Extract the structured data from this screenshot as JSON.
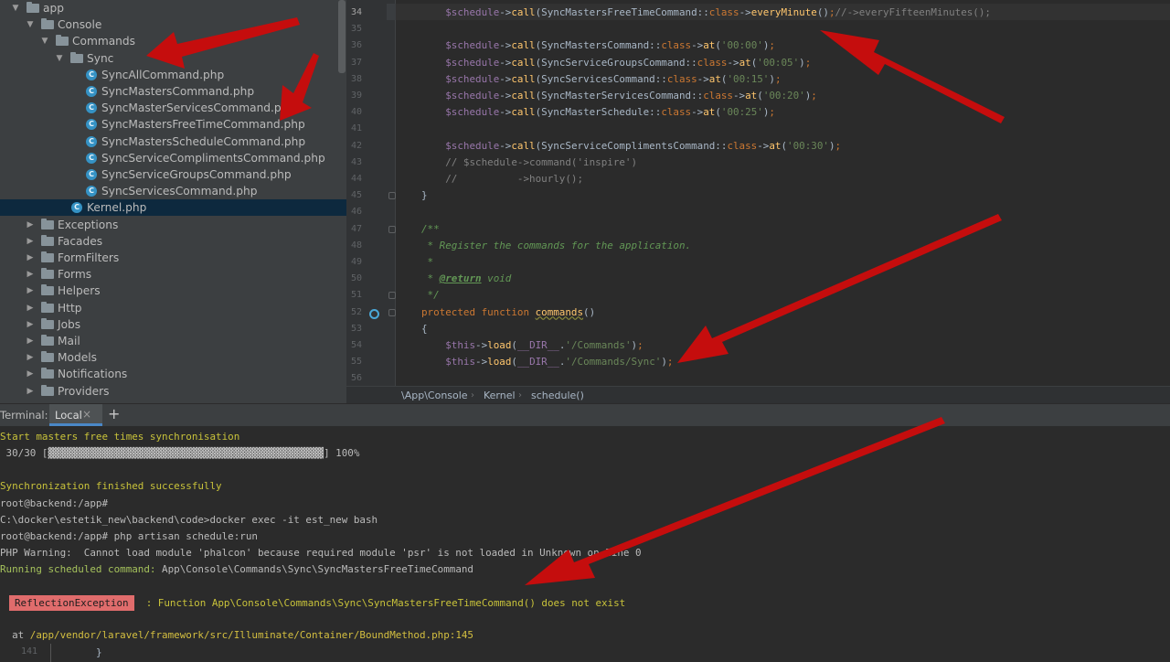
{
  "tree": {
    "items": [
      {
        "label": "app",
        "kind": "folder",
        "open": true,
        "depth": 0
      },
      {
        "label": "Console",
        "kind": "folder",
        "open": true,
        "depth": 1
      },
      {
        "label": "Commands",
        "kind": "folder",
        "open": true,
        "depth": 2
      },
      {
        "label": "Sync",
        "kind": "folder",
        "open": true,
        "depth": 3
      },
      {
        "label": "SyncAllCommand.php",
        "kind": "php",
        "depth": 4
      },
      {
        "label": "SyncMastersCommand.php",
        "kind": "php",
        "depth": 4
      },
      {
        "label": "SyncMasterServicesCommand.php",
        "kind": "php",
        "depth": 4
      },
      {
        "label": "SyncMastersFreeTimeCommand.php",
        "kind": "php",
        "depth": 4
      },
      {
        "label": "SyncMastersScheduleCommand.php",
        "kind": "php",
        "depth": 4
      },
      {
        "label": "SyncServiceComplimentsCommand.php",
        "kind": "php",
        "depth": 4
      },
      {
        "label": "SyncServiceGroupsCommand.php",
        "kind": "php",
        "depth": 4
      },
      {
        "label": "SyncServicesCommand.php",
        "kind": "php",
        "depth": 4
      },
      {
        "label": "Kernel.php",
        "kind": "php",
        "depth": 3,
        "selected": true
      },
      {
        "label": "Exceptions",
        "kind": "folder",
        "open": false,
        "depth": 1
      },
      {
        "label": "Facades",
        "kind": "folder",
        "open": false,
        "depth": 1
      },
      {
        "label": "FormFilters",
        "kind": "folder",
        "open": false,
        "depth": 1
      },
      {
        "label": "Forms",
        "kind": "folder",
        "open": false,
        "depth": 1
      },
      {
        "label": "Helpers",
        "kind": "folder",
        "open": false,
        "depth": 1
      },
      {
        "label": "Http",
        "kind": "folder",
        "open": false,
        "depth": 1
      },
      {
        "label": "Jobs",
        "kind": "folder",
        "open": false,
        "depth": 1
      },
      {
        "label": "Mail",
        "kind": "folder",
        "open": false,
        "depth": 1
      },
      {
        "label": "Models",
        "kind": "folder",
        "open": false,
        "depth": 1
      },
      {
        "label": "Notifications",
        "kind": "folder",
        "open": false,
        "depth": 1
      },
      {
        "label": "Providers",
        "kind": "folder",
        "open": false,
        "depth": 1
      }
    ]
  },
  "editor": {
    "current_line": "34",
    "lines": [
      {
        "n": "34",
        "parts": [
          [
            "v",
            "$schedule"
          ],
          [
            "",
            "->"
          ],
          [
            "m",
            "call"
          ],
          [
            "",
            "(SyncMastersFreeTimeCommand::"
          ],
          [
            "k",
            "class"
          ],
          [
            "",
            "->"
          ],
          [
            "m",
            "everyMinute"
          ],
          [
            "",
            "()"
          ],
          [
            "k",
            ";"
          ],
          [
            "cm",
            "//->everyFifteenMinutes();"
          ]
        ],
        "indent": "    "
      },
      {
        "n": "35",
        "parts": [],
        "indent": ""
      },
      {
        "n": "36",
        "parts": [
          [
            "v",
            "$schedule"
          ],
          [
            "",
            "->"
          ],
          [
            "m",
            "call"
          ],
          [
            "",
            "(SyncMastersCommand::"
          ],
          [
            "k",
            "class"
          ],
          [
            "",
            "->"
          ],
          [
            "m",
            "at"
          ],
          [
            "",
            "("
          ],
          [
            "s",
            "'00:00'"
          ],
          [
            "",
            ")"
          ],
          [
            "k",
            ";"
          ]
        ],
        "indent": "    "
      },
      {
        "n": "37",
        "parts": [
          [
            "v",
            "$schedule"
          ],
          [
            "",
            "->"
          ],
          [
            "m",
            "call"
          ],
          [
            "",
            "(SyncServiceGroupsCommand::"
          ],
          [
            "k",
            "class"
          ],
          [
            "",
            "->"
          ],
          [
            "m",
            "at"
          ],
          [
            "",
            "("
          ],
          [
            "s",
            "'00:05'"
          ],
          [
            "",
            ")"
          ],
          [
            "k",
            ";"
          ]
        ],
        "indent": "    "
      },
      {
        "n": "38",
        "parts": [
          [
            "v",
            "$schedule"
          ],
          [
            "",
            "->"
          ],
          [
            "m",
            "call"
          ],
          [
            "",
            "(SyncServicesCommand::"
          ],
          [
            "k",
            "class"
          ],
          [
            "",
            "->"
          ],
          [
            "m",
            "at"
          ],
          [
            "",
            "("
          ],
          [
            "s",
            "'00:15'"
          ],
          [
            "",
            ")"
          ],
          [
            "k",
            ";"
          ]
        ],
        "indent": "    "
      },
      {
        "n": "39",
        "parts": [
          [
            "v",
            "$schedule"
          ],
          [
            "",
            "->"
          ],
          [
            "m",
            "call"
          ],
          [
            "",
            "(SyncMasterServicesCommand::"
          ],
          [
            "k",
            "class"
          ],
          [
            "",
            "->"
          ],
          [
            "m",
            "at"
          ],
          [
            "",
            "("
          ],
          [
            "s",
            "'00:20'"
          ],
          [
            "",
            ")"
          ],
          [
            "k",
            ";"
          ]
        ],
        "indent": "    "
      },
      {
        "n": "40",
        "parts": [
          [
            "v",
            "$schedule"
          ],
          [
            "",
            "->"
          ],
          [
            "m",
            "call"
          ],
          [
            "",
            "(SyncMasterSchedule::"
          ],
          [
            "k",
            "class"
          ],
          [
            "",
            "->"
          ],
          [
            "m",
            "at"
          ],
          [
            "",
            "("
          ],
          [
            "s",
            "'00:25'"
          ],
          [
            "",
            ")"
          ],
          [
            "k",
            ";"
          ]
        ],
        "indent": "    "
      },
      {
        "n": "41",
        "parts": [],
        "indent": ""
      },
      {
        "n": "42",
        "parts": [
          [
            "v",
            "$schedule"
          ],
          [
            "",
            "->"
          ],
          [
            "m",
            "call"
          ],
          [
            "",
            "(SyncServiceComplimentsCommand::"
          ],
          [
            "k",
            "class"
          ],
          [
            "",
            "->"
          ],
          [
            "m",
            "at"
          ],
          [
            "",
            "("
          ],
          [
            "s",
            "'00:30'"
          ],
          [
            "",
            ")"
          ],
          [
            "k",
            ";"
          ]
        ],
        "indent": "    "
      },
      {
        "n": "43",
        "parts": [
          [
            "cm",
            "// $schedule->command('inspire')"
          ]
        ],
        "indent": "    "
      },
      {
        "n": "44",
        "parts": [
          [
            "cm",
            "//          ->hourly();"
          ]
        ],
        "indent": "    "
      },
      {
        "n": "45",
        "parts": [
          [
            "",
            "}"
          ]
        ],
        "indent": ""
      },
      {
        "n": "46",
        "parts": [],
        "indent": ""
      },
      {
        "n": "47",
        "parts": [
          [
            "dc",
            "/**"
          ]
        ],
        "indent": ""
      },
      {
        "n": "48",
        "parts": [
          [
            "dc",
            " * Register the commands for the application."
          ]
        ],
        "indent": ""
      },
      {
        "n": "49",
        "parts": [
          [
            "dc",
            " *"
          ]
        ],
        "indent": ""
      },
      {
        "n": "50",
        "parts": [
          [
            "dc",
            " * "
          ],
          [
            "dt",
            "@return"
          ],
          [
            "dc",
            " void"
          ]
        ],
        "indent": ""
      },
      {
        "n": "51",
        "parts": [
          [
            "dc",
            " */"
          ]
        ],
        "indent": ""
      },
      {
        "n": "52",
        "parts": [
          [
            "k",
            "protected function "
          ],
          [
            "mw",
            "commands"
          ],
          [
            "",
            "()"
          ]
        ],
        "indent": ""
      },
      {
        "n": "53",
        "parts": [
          [
            "",
            "{"
          ]
        ],
        "indent": ""
      },
      {
        "n": "54",
        "parts": [
          [
            "v",
            "$this"
          ],
          [
            "",
            "->"
          ],
          [
            "m",
            "load"
          ],
          [
            "",
            "("
          ],
          [
            "v",
            "__DIR__"
          ],
          [
            "",
            "."
          ],
          [
            "s",
            "'/Commands'"
          ],
          [
            "",
            ")"
          ],
          [
            "k",
            ";"
          ]
        ],
        "indent": "    "
      },
      {
        "n": "55",
        "parts": [
          [
            "v",
            "$this"
          ],
          [
            "",
            "->"
          ],
          [
            "m",
            "load"
          ],
          [
            "",
            "("
          ],
          [
            "v",
            "__DIR__"
          ],
          [
            "",
            "."
          ],
          [
            "s",
            "'/Commands/Sync'"
          ],
          [
            "",
            ")"
          ],
          [
            "k",
            ";"
          ]
        ],
        "indent": "    "
      },
      {
        "n": "56",
        "parts": [],
        "indent": ""
      }
    ]
  },
  "breadcrumb": {
    "items": [
      "\\App\\Console",
      "Kernel",
      "schedule()"
    ]
  },
  "terminal": {
    "label": "Terminal:",
    "tab_label": "Local",
    "tab_close": "×",
    "add_tab": "+",
    "lines": {
      "start": "Start masters free times synchronisation",
      "progress": " 30/30 [▓▓▓▓▓▓▓▓▓▓▓▓▓▓▓▓▓▓▓▓▓▓▓▓▓▓▓▓▓▓▓▓▓▓▓▓▓▓▓▓▓▓▓▓▓▓] 100%",
      "finished": "Synchronization finished successfully",
      "prompt1": "root@backend:/app#",
      "docker_cmd": "C:\\docker\\estetik_new\\backend\\code>docker exec -it est_new bash",
      "prompt2": "root@backend:/app# php artisan schedule:run",
      "warning": "PHP Warning:  Cannot load module 'phalcon' because required module 'psr' is not loaded in Unknown on line 0",
      "running_label": "Running scheduled command:",
      "running_cmd": " App\\Console\\Commands\\Sync\\SyncMastersFreeTimeCommand",
      "exception_name": "ReflectionException",
      "exception_msg": "  : Function App\\Console\\Commands\\Sync\\SyncMastersFreeTimeCommand() does not exist",
      "at_prefix": "  at ",
      "at_path": "/app/vendor/laravel/framework/src/Illuminate/Container/BoundMethod.php:145",
      "code_line_no": "141",
      "code_line": "}"
    }
  },
  "colors": {
    "annotation_arrow": "#c50d0d",
    "selection": "#0d293e",
    "php_icon": "#3592c4"
  }
}
